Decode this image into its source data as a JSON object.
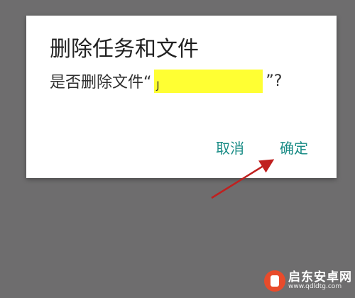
{
  "dialog": {
    "title": "删除任务和文件",
    "message_prefix": "是否删除文件“",
    "filename": "J",
    "message_suffix": "”?",
    "cancel_label": "取消",
    "confirm_label": "确定"
  },
  "watermark": {
    "name": "启东安卓网",
    "url": "www.qdldtg.com"
  },
  "colors": {
    "background": "#6e6d6e",
    "dialog": "#ffffff",
    "accent": "#1a8c86",
    "highlight": "#ffff33",
    "annotation_arrow": "#c0201f"
  }
}
